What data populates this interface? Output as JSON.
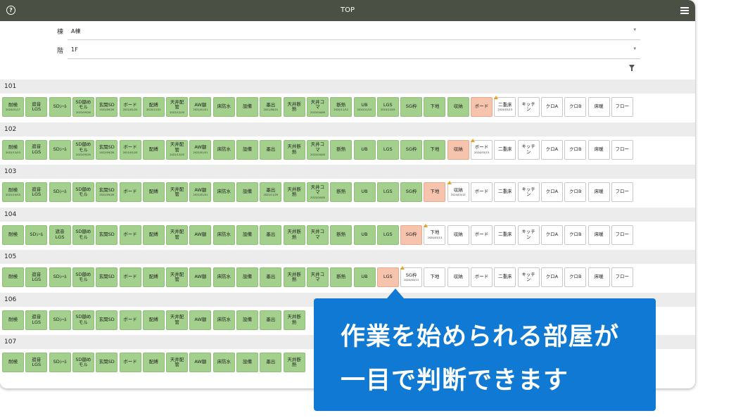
{
  "topbar": {
    "title": "TOP",
    "help_glyph": "?",
    "help_icon": "help-circle-icon",
    "menu_icon": "hamburger-menu-icon"
  },
  "filters": [
    {
      "label": "棟",
      "value": "A棟"
    },
    {
      "label": "階",
      "value": "1F"
    }
  ],
  "filter_icon": "funnel-icon",
  "rooms": [
    {
      "name": "101",
      "tasks": [
        {
          "label": "耐検",
          "state": "done",
          "date": "2024/01/17"
        },
        {
          "label": "遮音\nLGS",
          "state": "done",
          "date": ""
        },
        {
          "label": "SDｼｰﾙ",
          "state": "done",
          "date": ""
        },
        {
          "label": "SD額め\nモル",
          "state": "done",
          "date": "2022/09/26"
        },
        {
          "label": "玄関SD",
          "state": "done",
          "date": "2022/09/26"
        },
        {
          "label": "ボード",
          "state": "done",
          "date": "2021/02/20"
        },
        {
          "label": "配縛",
          "state": "done",
          "date": "2020/12/31"
        },
        {
          "label": "天井配\n管",
          "state": "done",
          "date": "2022/12/20"
        },
        {
          "label": "AW額",
          "state": "done",
          "date": "2021/01/01"
        },
        {
          "label": "床防水",
          "state": "done",
          "date": ""
        },
        {
          "label": "設備",
          "state": "done",
          "date": ""
        },
        {
          "label": "墨出",
          "state": "done",
          "date": "2021/06/21"
        },
        {
          "label": "天井断\n熱",
          "state": "done",
          "date": ""
        },
        {
          "label": "天井コ\nマ",
          "state": "done",
          "date": "2022/04/08"
        },
        {
          "label": "断熱",
          "state": "done",
          "date": "2020/11/12"
        },
        {
          "label": "UB",
          "state": "done",
          "date": "2020/11/15"
        },
        {
          "label": "LGS",
          "state": "done",
          "date": "2023/12/05"
        },
        {
          "label": "SG枠",
          "state": "done",
          "date": ""
        },
        {
          "label": "下地",
          "state": "done",
          "date": ""
        },
        {
          "label": "収納",
          "state": "done",
          "date": ""
        },
        {
          "label": "ボード",
          "state": "ready",
          "date": ""
        },
        {
          "label": "二重床",
          "state": "pending",
          "date": "2024/03/13",
          "warn": true
        },
        {
          "label": "キッチ\nン",
          "state": "pending",
          "date": ""
        },
        {
          "label": "クロA",
          "state": "pending",
          "date": ""
        },
        {
          "label": "クロB",
          "state": "pending",
          "date": ""
        },
        {
          "label": "床暖",
          "state": "pending",
          "date": ""
        },
        {
          "label": "フロー",
          "state": "pending",
          "date": ""
        }
      ]
    },
    {
      "name": "102",
      "tasks": [
        {
          "label": "耐検",
          "state": "done",
          "date": "2022/12/03"
        },
        {
          "label": "遮音\nLGS",
          "state": "done",
          "date": ""
        },
        {
          "label": "SDｼｰﾙ",
          "state": "done",
          "date": ""
        },
        {
          "label": "SD額め\nモル",
          "state": "done",
          "date": "2022/09/26"
        },
        {
          "label": "玄関SD",
          "state": "done",
          "date": "2022/09/26"
        },
        {
          "label": "ボード",
          "state": "done",
          "date": "2021/02/20"
        },
        {
          "label": "配縛",
          "state": "done",
          "date": ""
        },
        {
          "label": "天井配\n管",
          "state": "done",
          "date": "2022/12/20"
        },
        {
          "label": "AW額",
          "state": "done",
          "date": "2021/01/01"
        },
        {
          "label": "床防水",
          "state": "done",
          "date": ""
        },
        {
          "label": "設備",
          "state": "done",
          "date": ""
        },
        {
          "label": "墨出",
          "state": "done",
          "date": ""
        },
        {
          "label": "天井断\n熱",
          "state": "done",
          "date": ""
        },
        {
          "label": "天井コ\nマ",
          "state": "done",
          "date": "2022/04/08"
        },
        {
          "label": "断熱",
          "state": "done",
          "date": ""
        },
        {
          "label": "UB",
          "state": "done",
          "date": ""
        },
        {
          "label": "LGS",
          "state": "done",
          "date": ""
        },
        {
          "label": "SG枠",
          "state": "done",
          "date": ""
        },
        {
          "label": "下地",
          "state": "done",
          "date": ""
        },
        {
          "label": "収納",
          "state": "ready",
          "date": ""
        },
        {
          "label": "ボード",
          "state": "pending",
          "date": "2024/03/13",
          "warn": true
        },
        {
          "label": "二重床",
          "state": "pending",
          "date": ""
        },
        {
          "label": "キッチ\nン",
          "state": "pending",
          "date": ""
        },
        {
          "label": "クロA",
          "state": "pending",
          "date": ""
        },
        {
          "label": "クロB",
          "state": "pending",
          "date": ""
        },
        {
          "label": "床暖",
          "state": "pending",
          "date": ""
        },
        {
          "label": "フロー",
          "state": "pending",
          "date": ""
        }
      ]
    },
    {
      "name": "103",
      "tasks": [
        {
          "label": "耐検",
          "state": "done",
          "date": "2022/10/03"
        },
        {
          "label": "遮音\nLGS",
          "state": "done",
          "date": ""
        },
        {
          "label": "SDｼｰﾙ",
          "state": "done",
          "date": ""
        },
        {
          "label": "SD額め\nモル",
          "state": "done",
          "date": ""
        },
        {
          "label": "玄関SD",
          "state": "done",
          "date": "2022/09/26"
        },
        {
          "label": "ボード",
          "state": "done",
          "date": ""
        },
        {
          "label": "配縛",
          "state": "done",
          "date": ""
        },
        {
          "label": "天井配\n管",
          "state": "done",
          "date": ""
        },
        {
          "label": "AW額",
          "state": "done",
          "date": "2021/01/01"
        },
        {
          "label": "床防水",
          "state": "done",
          "date": ""
        },
        {
          "label": "設備",
          "state": "done",
          "date": ""
        },
        {
          "label": "墨出",
          "state": "done",
          "date": "2022/11/29"
        },
        {
          "label": "天井断\n熱",
          "state": "done",
          "date": ""
        },
        {
          "label": "天井コ\nマ",
          "state": "done",
          "date": "2022/04/08"
        },
        {
          "label": "断熱",
          "state": "done",
          "date": ""
        },
        {
          "label": "UB",
          "state": "done",
          "date": ""
        },
        {
          "label": "LGS",
          "state": "done",
          "date": ""
        },
        {
          "label": "SG枠",
          "state": "done",
          "date": ""
        },
        {
          "label": "下地",
          "state": "ready",
          "date": ""
        },
        {
          "label": "収納",
          "state": "pending",
          "date": "2024/03/13",
          "warn": true
        },
        {
          "label": "ボード",
          "state": "pending",
          "date": ""
        },
        {
          "label": "二重床",
          "state": "pending",
          "date": ""
        },
        {
          "label": "キッチ\nン",
          "state": "pending",
          "date": ""
        },
        {
          "label": "クロA",
          "state": "pending",
          "date": ""
        },
        {
          "label": "クロB",
          "state": "pending",
          "date": ""
        },
        {
          "label": "床暖",
          "state": "pending",
          "date": ""
        },
        {
          "label": "フロー",
          "state": "pending",
          "date": ""
        }
      ]
    },
    {
      "name": "104",
      "tasks": [
        {
          "label": "耐検",
          "state": "done",
          "date": ""
        },
        {
          "label": "SDｼｰﾙ",
          "state": "done",
          "date": ""
        },
        {
          "label": "遮音\nLGS",
          "state": "done",
          "date": ""
        },
        {
          "label": "SD額め\nモル",
          "state": "done",
          "date": ""
        },
        {
          "label": "玄関SD",
          "state": "done",
          "date": ""
        },
        {
          "label": "ボード",
          "state": "done",
          "date": ""
        },
        {
          "label": "配縛",
          "state": "done",
          "date": ""
        },
        {
          "label": "天井配\n管",
          "state": "done",
          "date": ""
        },
        {
          "label": "AW額",
          "state": "done",
          "date": ""
        },
        {
          "label": "床防水",
          "state": "done",
          "date": ""
        },
        {
          "label": "設備",
          "state": "done",
          "date": ""
        },
        {
          "label": "墨出",
          "state": "done",
          "date": ""
        },
        {
          "label": "天井断\n熱",
          "state": "done",
          "date": ""
        },
        {
          "label": "天井コ\nマ",
          "state": "done",
          "date": ""
        },
        {
          "label": "断熱",
          "state": "done",
          "date": ""
        },
        {
          "label": "UB",
          "state": "done",
          "date": ""
        },
        {
          "label": "LGS",
          "state": "done",
          "date": ""
        },
        {
          "label": "SG枠",
          "state": "ready",
          "date": ""
        },
        {
          "label": "下地",
          "state": "pending",
          "date": "2024/03/13",
          "warn": true
        },
        {
          "label": "収納",
          "state": "pending",
          "date": ""
        },
        {
          "label": "ボード",
          "state": "pending",
          "date": ""
        },
        {
          "label": "二重床",
          "state": "pending",
          "date": ""
        },
        {
          "label": "キッチ\nン",
          "state": "pending",
          "date": ""
        },
        {
          "label": "クロA",
          "state": "pending",
          "date": ""
        },
        {
          "label": "クロB",
          "state": "pending",
          "date": ""
        },
        {
          "label": "床暖",
          "state": "pending",
          "date": ""
        },
        {
          "label": "フロー",
          "state": "pending",
          "date": ""
        }
      ]
    },
    {
      "name": "105",
      "tasks": [
        {
          "label": "耐検",
          "state": "done",
          "date": ""
        },
        {
          "label": "遮音\nLGS",
          "state": "done",
          "date": ""
        },
        {
          "label": "SDｼｰﾙ",
          "state": "done",
          "date": ""
        },
        {
          "label": "SD額め\nモル",
          "state": "done",
          "date": ""
        },
        {
          "label": "玄関SD",
          "state": "done",
          "date": ""
        },
        {
          "label": "ボード",
          "state": "done",
          "date": ""
        },
        {
          "label": "配縛",
          "state": "done",
          "date": ""
        },
        {
          "label": "天井配\n管",
          "state": "done",
          "date": ""
        },
        {
          "label": "AW額",
          "state": "done",
          "date": ""
        },
        {
          "label": "床防水",
          "state": "done",
          "date": ""
        },
        {
          "label": "設備",
          "state": "done",
          "date": ""
        },
        {
          "label": "墨出",
          "state": "done",
          "date": ""
        },
        {
          "label": "天井断\n熱",
          "state": "done",
          "date": ""
        },
        {
          "label": "天井コ\nマ",
          "state": "done",
          "date": ""
        },
        {
          "label": "断熱",
          "state": "done",
          "date": ""
        },
        {
          "label": "UB",
          "state": "done",
          "date": ""
        },
        {
          "label": "LGS",
          "state": "ready",
          "date": ""
        },
        {
          "label": "SG枠",
          "state": "pending",
          "date": "2024/03/13",
          "warn": true
        },
        {
          "label": "下地",
          "state": "pending",
          "date": ""
        },
        {
          "label": "収納",
          "state": "pending",
          "date": ""
        },
        {
          "label": "ボード",
          "state": "pending",
          "date": ""
        },
        {
          "label": "二重床",
          "state": "pending",
          "date": ""
        },
        {
          "label": "キッチ\nン",
          "state": "pending",
          "date": ""
        },
        {
          "label": "クロA",
          "state": "pending",
          "date": ""
        },
        {
          "label": "クロB",
          "state": "pending",
          "date": ""
        },
        {
          "label": "床暖",
          "state": "pending",
          "date": ""
        },
        {
          "label": "フロー",
          "state": "pending",
          "date": ""
        }
      ]
    },
    {
      "name": "106",
      "tasks": [
        {
          "label": "耐検",
          "state": "done",
          "date": ""
        },
        {
          "label": "遮音\nLGS",
          "state": "done",
          "date": ""
        },
        {
          "label": "SDｼｰﾙ",
          "state": "done",
          "date": ""
        },
        {
          "label": "SD額め\nモル",
          "state": "done",
          "date": ""
        },
        {
          "label": "玄関SD",
          "state": "done",
          "date": ""
        },
        {
          "label": "ボード",
          "state": "done",
          "date": ""
        },
        {
          "label": "配縛",
          "state": "done",
          "date": ""
        },
        {
          "label": "天井配\n管",
          "state": "done",
          "date": ""
        },
        {
          "label": "AW額",
          "state": "done",
          "date": ""
        },
        {
          "label": "床防水",
          "state": "done",
          "date": ""
        },
        {
          "label": "設備",
          "state": "done",
          "date": ""
        },
        {
          "label": "墨出",
          "state": "done",
          "date": ""
        },
        {
          "label": "天井断\n熱",
          "state": "done",
          "date": ""
        }
      ]
    },
    {
      "name": "107",
      "tasks": [
        {
          "label": "耐検",
          "state": "done",
          "date": ""
        },
        {
          "label": "遮音\nLGS",
          "state": "done",
          "date": ""
        },
        {
          "label": "SDｼｰﾙ",
          "state": "done",
          "date": ""
        },
        {
          "label": "SD額め\nモル",
          "state": "done",
          "date": ""
        },
        {
          "label": "玄関SD",
          "state": "done",
          "date": ""
        },
        {
          "label": "ボード",
          "state": "done",
          "date": ""
        },
        {
          "label": "配縛",
          "state": "done",
          "date": ""
        },
        {
          "label": "天井配\n管",
          "state": "done",
          "date": ""
        },
        {
          "label": "AW額",
          "state": "done",
          "date": ""
        },
        {
          "label": "床防水",
          "state": "done",
          "date": ""
        },
        {
          "label": "設備",
          "state": "done",
          "date": ""
        },
        {
          "label": "墨出",
          "state": "done",
          "date": ""
        },
        {
          "label": "天井断\n熱",
          "state": "done",
          "date": ""
        }
      ]
    }
  ],
  "callout": {
    "line1": "作業を始められる部屋が",
    "line2": "一目で判断できます"
  },
  "colors": {
    "done": "#a3d08d",
    "ready": "#f6c4ad",
    "pending": "#ffffff",
    "topbar": "#4b5045",
    "callout": "#0f79d3",
    "warning": "#f0a020"
  }
}
